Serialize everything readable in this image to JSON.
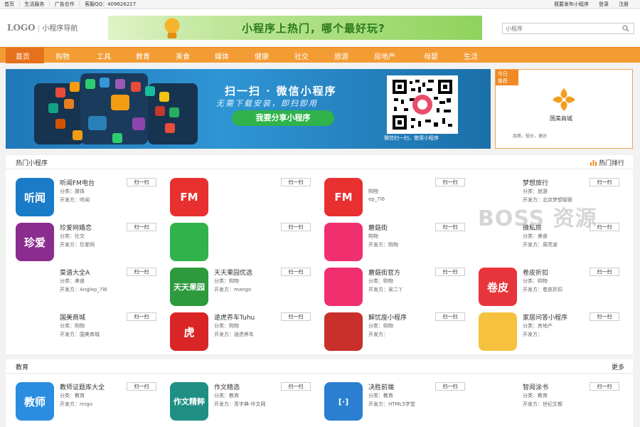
{
  "topbar": {
    "links": [
      "首页",
      "生活服务",
      "广告合作",
      "客服QQ：409626227"
    ],
    "right": [
      "我要发布小程序",
      "登录",
      "注册"
    ]
  },
  "header": {
    "logo": "LOGO",
    "logo_sub": "小程序导航",
    "banner_text": "小程序上热门，哪个最好玩?",
    "search_placeholder": "小程序"
  },
  "nav": {
    "items": [
      "首页",
      "购物",
      "工具",
      "教育",
      "美食",
      "媒体",
      "健康",
      "社交",
      "旅游",
      "房地产",
      "母婴",
      "生活"
    ]
  },
  "hero": {
    "slogan": "扫一扫 · 微信小程序",
    "sub": "无需下载安装，即扫即用",
    "share_button": "我要分享小程序",
    "qr_caption": "微信扫一扫，使用小程序"
  },
  "recommend": {
    "tag_line1": "今日",
    "tag_line2": "推荐",
    "name": "国美商城",
    "meta": "品质，低价，速达"
  },
  "hot": {
    "title": "热门小程序",
    "more": "热门排行",
    "scan_label": "扫一扫",
    "cards": [
      {
        "name": "听闻FM电台",
        "c1": "分类：媒体",
        "c2": "开发方：听闻",
        "color": "#1a7bc8",
        "glyph": "听闻"
      },
      {
        "name": "",
        "c1": "",
        "c2": "",
        "color": "#e83030",
        "glyph": "FM"
      },
      {
        "name": "",
        "c1": "购物",
        "c2": "ep_7l6",
        "color": "#e83030",
        "glyph": "FM"
      },
      {
        "name": "梦想旅行",
        "c1": "分类：旅游",
        "c2": "开发方：北京梦想智联",
        "color": "#ffffff",
        "glyph": ""
      },
      {
        "name": "珍爱网婚恋",
        "c1": "分类：社交",
        "c2": "开发方：珍爱网",
        "color": "#8b2c8f",
        "glyph": "珍爱"
      },
      {
        "name": "",
        "c1": "",
        "c2": "",
        "color": "#2fb34a",
        "glyph": ""
      },
      {
        "name": "蘑菇街",
        "c1": "购物",
        "c2": "开发方：购物",
        "color": "#f0306e",
        "glyph": ""
      },
      {
        "name": "微私房",
        "c1": "分类：美食",
        "c2": "开发方：周亮波",
        "color": "#ffffff",
        "glyph": ""
      },
      {
        "name": "菜谱大全A",
        "c1": "分类：美食",
        "c2": "开发方：Anglep_7l6",
        "color": "#ffffff",
        "glyph": ""
      },
      {
        "name": "天天果园优选",
        "c1": "分类：购物",
        "c2": "开发方：mango",
        "color": "#2e9a3e",
        "glyph": "天天果园"
      },
      {
        "name": "蘑菇街官方",
        "c1": "分类：购物",
        "c2": "开发方：吴二丫",
        "color": "#f0306e",
        "glyph": ""
      },
      {
        "name": "卷皮折扣",
        "c1": "分类：购物",
        "c2": "开发方：卷皮折扣",
        "color": "#e8353b",
        "glyph": "卷皮"
      },
      {
        "name": "国美商城",
        "c1": "分类：购物",
        "c2": "开发方：国美商城",
        "color": "#ffffff",
        "glyph": ""
      },
      {
        "name": "途虎养车Tuhu",
        "c1": "分类：购物",
        "c2": "开发方：途虎养车",
        "color": "#d92526",
        "glyph": "虎"
      },
      {
        "name": "解忧座小程序",
        "c1": "分类：购物",
        "c2": "开发方：",
        "color": "#c9302c",
        "glyph": ""
      },
      {
        "name": "家居问答小程序",
        "c1": "分类：房地产",
        "c2": "开发方：",
        "color": "#f6c23e",
        "glyph": ""
      }
    ]
  },
  "edu": {
    "title": "教育",
    "more": "更多",
    "scan_label": "扫一扫",
    "cards": [
      {
        "name": "教师证题库大全",
        "c1": "分类：教育",
        "c2": "开发方：ringo",
        "color": "#2a8de0",
        "glyph": "教师"
      },
      {
        "name": "作文精选",
        "c1": "分类：教育",
        "c2": "开发方：青字典-作文网",
        "color": "#1f8f84",
        "glyph": "作文精粹"
      },
      {
        "name": "决胜前端",
        "c1": "分类：教育",
        "c2": "开发方：HTML5学堂",
        "color": "#2a7fd0",
        "glyph": "[·]"
      },
      {
        "name": "智阅涂书",
        "c1": "分类：教育",
        "c2": "开发方：世纪文都",
        "color": "#ffffff",
        "glyph": ""
      }
    ]
  },
  "watermark": "BOSS 资源",
  "colors": {
    "nav": "#f39c34",
    "nav_active": "#e6711b",
    "hero": "#2f95d4",
    "share": "#2fb34a"
  }
}
